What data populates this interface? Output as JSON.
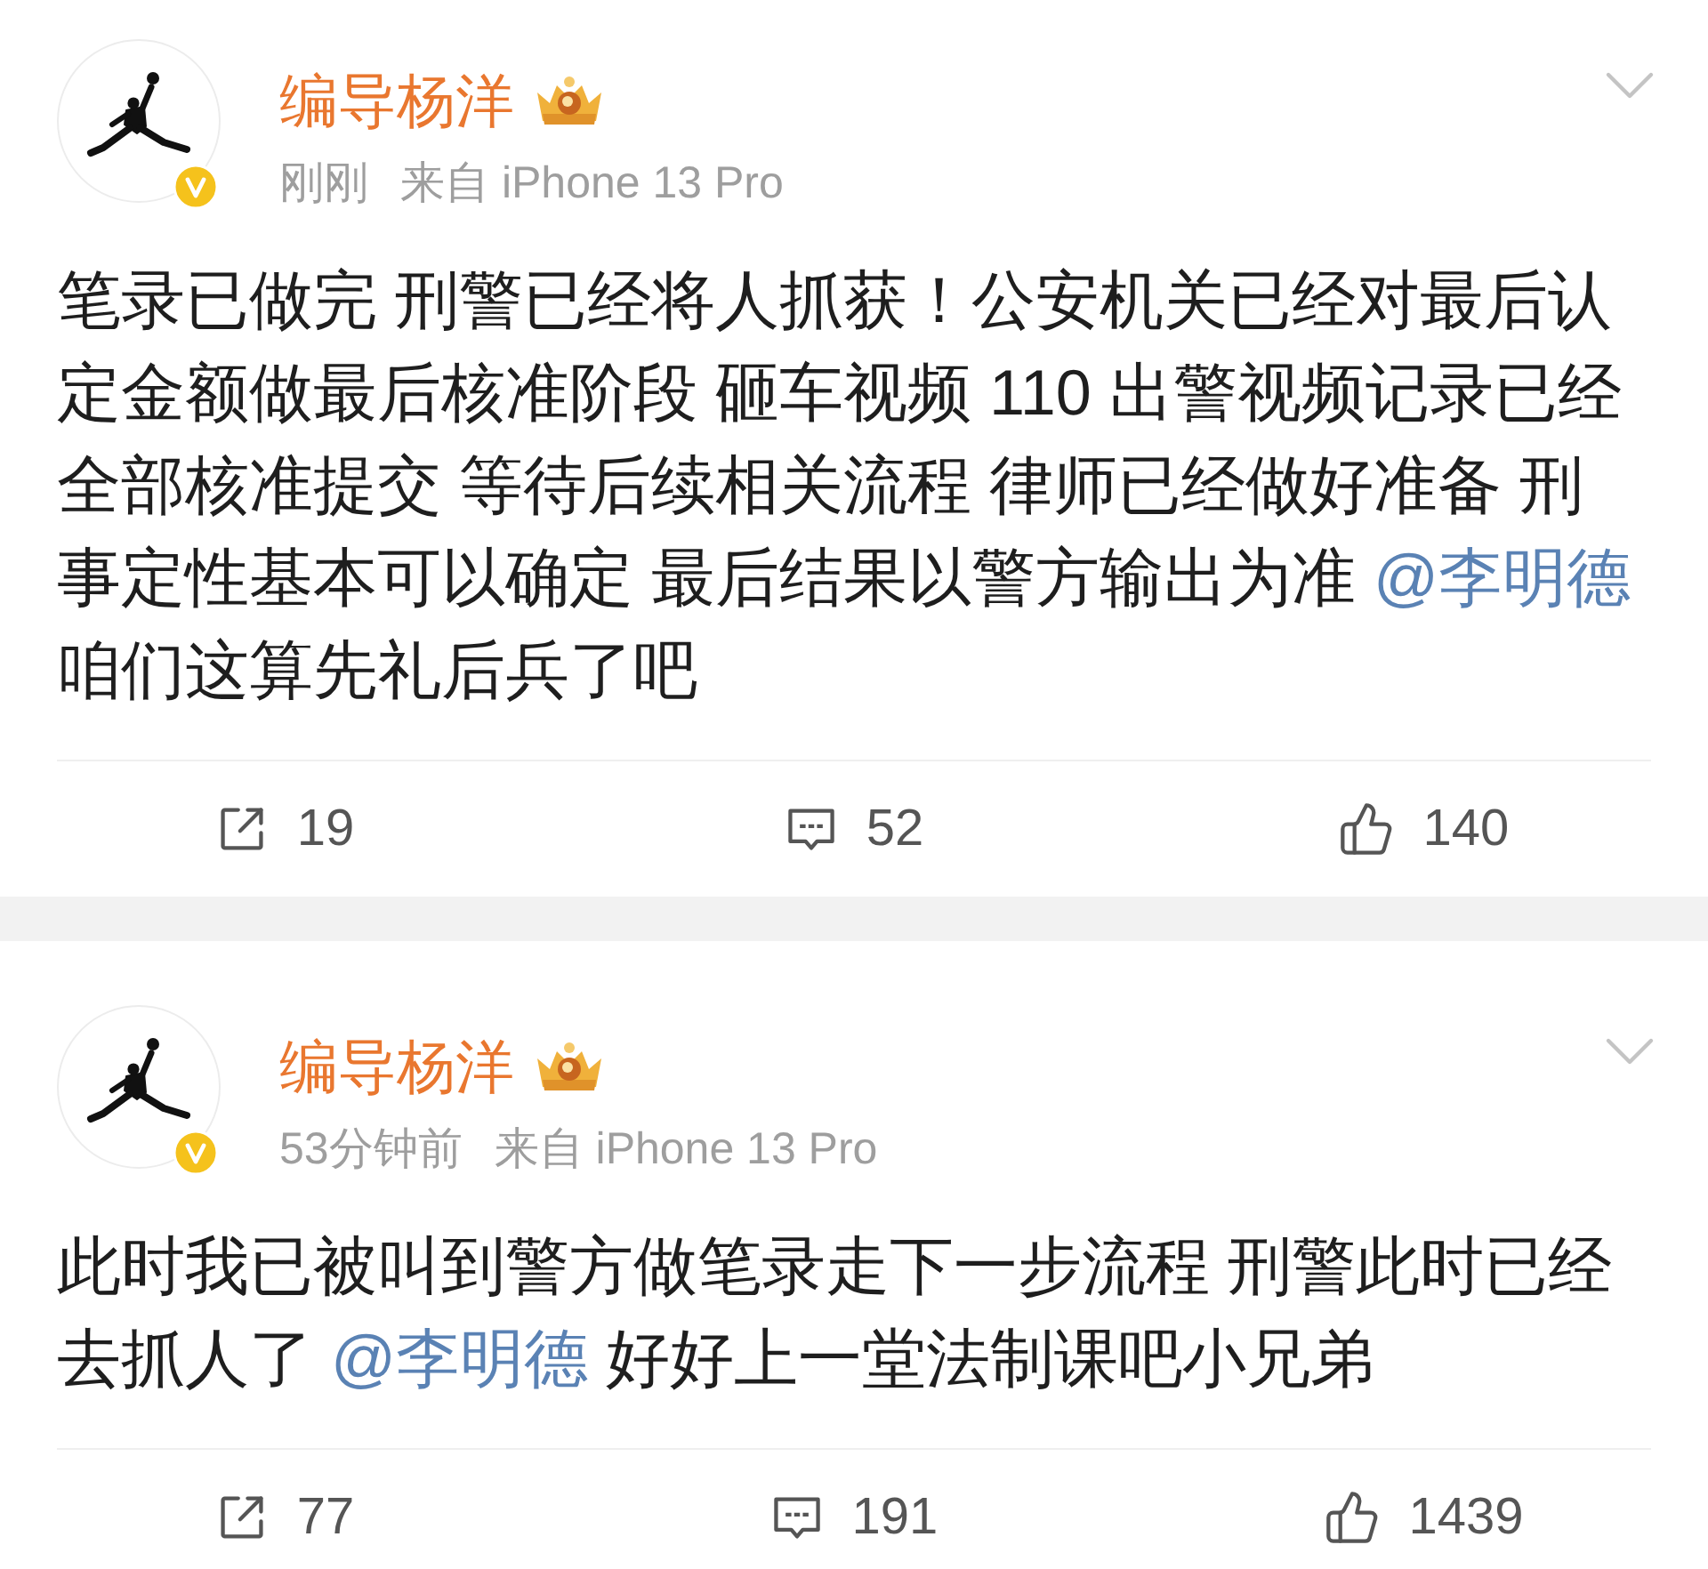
{
  "posts": [
    {
      "author": {
        "name": "编导杨洋",
        "verified": true
      },
      "time": "刚刚",
      "source": "来自 iPhone 13 Pro",
      "content": [
        {
          "kind": "text",
          "text": "笔录已做完 刑警已经将人抓获！公安机关已经对最后认定金额做最后核准阶段 砸车视频 110 出警视频记录已经全部核准提交  等待后续相关流程 律师已经做好准备 刑事定性基本可以确定 最后结果以警方输出为准 "
        },
        {
          "kind": "mention",
          "text": "@李明德"
        },
        {
          "kind": "text",
          "text": " 咱们这算先礼后兵了吧"
        }
      ],
      "actions": [
        {
          "kind": "repost",
          "count": "19"
        },
        {
          "kind": "comment",
          "count": "52"
        },
        {
          "kind": "like",
          "count": "140"
        }
      ]
    },
    {
      "author": {
        "name": "编导杨洋",
        "verified": true
      },
      "time": "53分钟前",
      "source": "来自 iPhone 13 Pro",
      "content": [
        {
          "kind": "text",
          "text": "此时我已被叫到警方做笔录走下一步流程 刑警此时已经去抓人了 "
        },
        {
          "kind": "mention",
          "text": "@李明德"
        },
        {
          "kind": "text",
          "text": " 好好上一堂法制课吧小兄弟"
        }
      ],
      "actions": [
        {
          "kind": "repost",
          "count": "77"
        },
        {
          "kind": "comment",
          "count": "191"
        },
        {
          "kind": "like",
          "count": "1439"
        }
      ]
    }
  ]
}
